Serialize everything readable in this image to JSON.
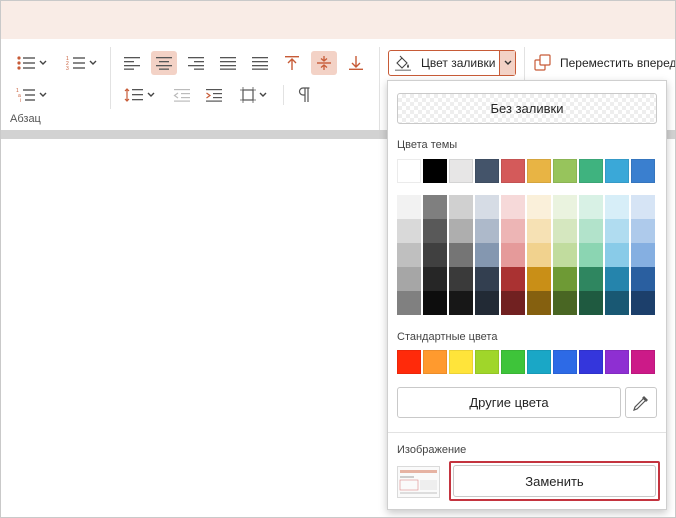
{
  "ribbon": {
    "group_label": "Абзац",
    "fill_button_label": "Цвет заливки",
    "move_forward_label": "Переместить вперед"
  },
  "fill_panel": {
    "no_fill_label": "Без заливки",
    "theme_colors_label": "Цвета темы",
    "theme_colors": [
      "#ffffff",
      "#000000",
      "#e7e6e6",
      "#44546a",
      "#d45a5a",
      "#e8b444",
      "#97c45c",
      "#3fb37f",
      "#3aa8d8",
      "#3a7fcf"
    ],
    "theme_shades": [
      [
        "#f2f2f2",
        "#d9d9d9",
        "#bfbfbf",
        "#a6a6a6",
        "#808080"
      ],
      [
        "#7f7f7f",
        "#595959",
        "#404040",
        "#262626",
        "#0d0d0d"
      ],
      [
        "#d0d0d0",
        "#aeaeae",
        "#757575",
        "#3a3a3a",
        "#171717"
      ],
      [
        "#d6dce5",
        "#adb9ca",
        "#8497b0",
        "#333f50",
        "#222a35"
      ],
      [
        "#f6d9d9",
        "#edb5b5",
        "#e59a9a",
        "#aa3232",
        "#712121"
      ],
      [
        "#faf0da",
        "#f6e1b4",
        "#f1d28e",
        "#c98f17",
        "#85600f"
      ],
      [
        "#eaf3df",
        "#d5e7bf",
        "#c1dc9e",
        "#6e9a35",
        "#496623"
      ],
      [
        "#d8f1e5",
        "#b2e3cb",
        "#8bd5b2",
        "#2f8660",
        "#1f5a40"
      ],
      [
        "#d7eef8",
        "#b0dcf0",
        "#89cbe8",
        "#2584ac",
        "#195873"
      ],
      [
        "#d6e4f5",
        "#aecaeb",
        "#85afe1",
        "#2a5fa0",
        "#1c3f6b"
      ]
    ],
    "standard_colors_label": "Стандартные цвета",
    "standard_colors": [
      "#ff2a0a",
      "#ff9a2e",
      "#ffe43a",
      "#a0d62a",
      "#3ec43a",
      "#1aa7c6",
      "#2d6ae6",
      "#3436dc",
      "#8e2fd2",
      "#cc1a88"
    ],
    "other_colors_label": "Другие цвета",
    "image_label": "Изображение",
    "replace_label": "Заменить"
  },
  "colors": {
    "accent": "#c75b37",
    "accent_light": "#f3d2c6",
    "titlebar": "#f9ece6",
    "highlight_border": "#c4343f"
  }
}
